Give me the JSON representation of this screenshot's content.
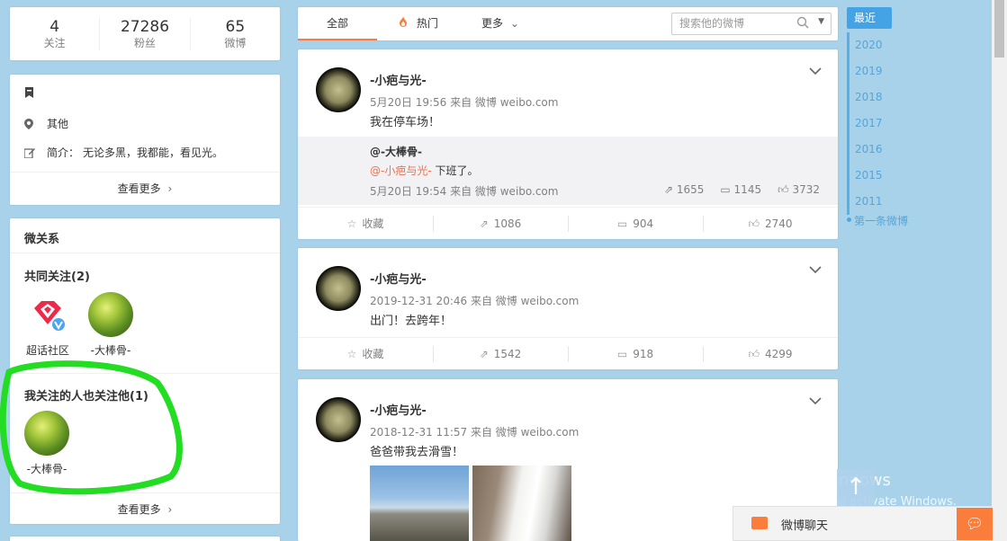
{
  "profile_stats": [
    {
      "num": "4",
      "label": "关注"
    },
    {
      "num": "27286",
      "label": "粉丝"
    },
    {
      "num": "65",
      "label": "微博"
    }
  ],
  "info": {
    "location": "其他",
    "bio_label": "简介：",
    "bio": "无论多黑，我都能，看见光。",
    "more": "查看更多"
  },
  "relations": {
    "title": "微关系",
    "common_title": "共同关注(2)",
    "common": [
      {
        "name": "超话社区"
      },
      {
        "name": "-大棒骨-"
      }
    ],
    "also_title": "我关注的人也关注他(1)",
    "also": [
      {
        "name": "-大棒骨-"
      }
    ],
    "more": "查看更多"
  },
  "tabs": {
    "all": "全部",
    "hot": "热门",
    "more": "更多",
    "search_placeholder": "搜索他的微博"
  },
  "posts": [
    {
      "author": "-小疤与光-",
      "meta": "5月20日 19:56 来自 微博 weibo.com",
      "text": "我在停车场！",
      "repost": {
        "author": "@-大棒骨-",
        "at": "@-小疤与光-",
        "text": " 下班了。",
        "meta": "5月20日 19:54 来自 微博 weibo.com",
        "reposts": "1655",
        "comments": "1145",
        "likes": "3732"
      },
      "actions": {
        "fav": "收藏",
        "repost": "1086",
        "comment": "904",
        "like": "2740"
      }
    },
    {
      "author": "-小疤与光-",
      "meta": "2019-12-31 20:46 来自 微博 weibo.com",
      "text": "出门！去跨年！",
      "actions": {
        "fav": "收藏",
        "repost": "1542",
        "comment": "918",
        "like": "4299"
      }
    },
    {
      "author": "-小疤与光-",
      "meta": "2018-12-31 11:57 来自 微博 weibo.com",
      "text": "爸爸带我去滑雪！"
    }
  ],
  "timeline": {
    "latest": "最近",
    "years": [
      "2020",
      "2019",
      "2018",
      "2017",
      "2016",
      "2015",
      "2011"
    ],
    "first": "第一条微博"
  },
  "watermark": {
    "line1": "Activate Windows",
    "line2": "Go to Settings to activate Windows."
  },
  "chat": {
    "label": "微博聊天"
  }
}
